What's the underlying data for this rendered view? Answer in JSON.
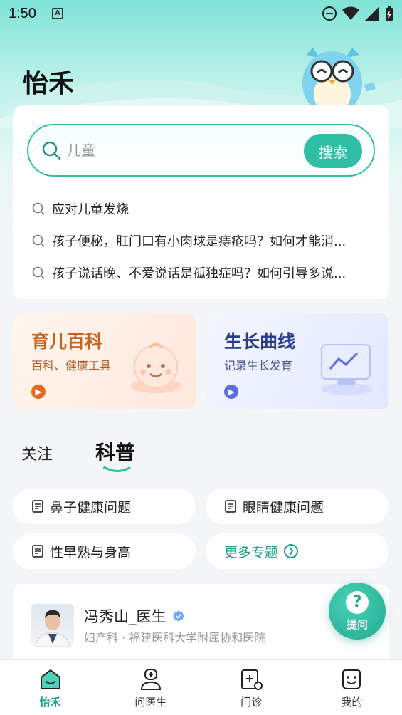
{
  "status_bar": {
    "time": "1:50",
    "badge": "A"
  },
  "app": {
    "title": "怡禾"
  },
  "search": {
    "placeholder": "儿童",
    "button_label": "搜索",
    "suggestions": [
      "应对儿童发烧",
      "孩子便秘，肛门口有小肉球是痔疮吗？如何才能消...",
      "孩子说话晚、不爱说话是孤独症吗？如何引导多说..."
    ]
  },
  "features": [
    {
      "title": "育儿百科",
      "subtitle": "百科、健康工具",
      "icon": "baby-face-icon"
    },
    {
      "title": "生长曲线",
      "subtitle": "记录生长发育",
      "icon": "growth-chart-monitor-icon"
    }
  ],
  "tabs": [
    {
      "label": "关注",
      "active": false
    },
    {
      "label": "科普",
      "active": true
    }
  ],
  "topics": [
    {
      "label": "鼻子健康问题"
    },
    {
      "label": "眼睛健康问题"
    },
    {
      "label": "性早熟与身高"
    },
    {
      "label": "更多专题"
    }
  ],
  "doctor": {
    "name": "冯秀山_医生",
    "department": "妇产科 · 福建医科大学附属协和医院"
  },
  "ask_button": {
    "label": "提问",
    "glyph": "?"
  },
  "bottom_nav": [
    {
      "label": "怡禾",
      "active": true,
      "icon": "home-icon"
    },
    {
      "label": "问医生",
      "active": false,
      "icon": "doctor-icon"
    },
    {
      "label": "门诊",
      "active": false,
      "icon": "clinic-icon"
    },
    {
      "label": "我的",
      "active": false,
      "icon": "smile-face-icon"
    }
  ],
  "colors": {
    "accent": "#2fbfa5",
    "accent_dark": "#1e9e88",
    "orange": "#c8601e",
    "navy": "#2a3d8f"
  }
}
